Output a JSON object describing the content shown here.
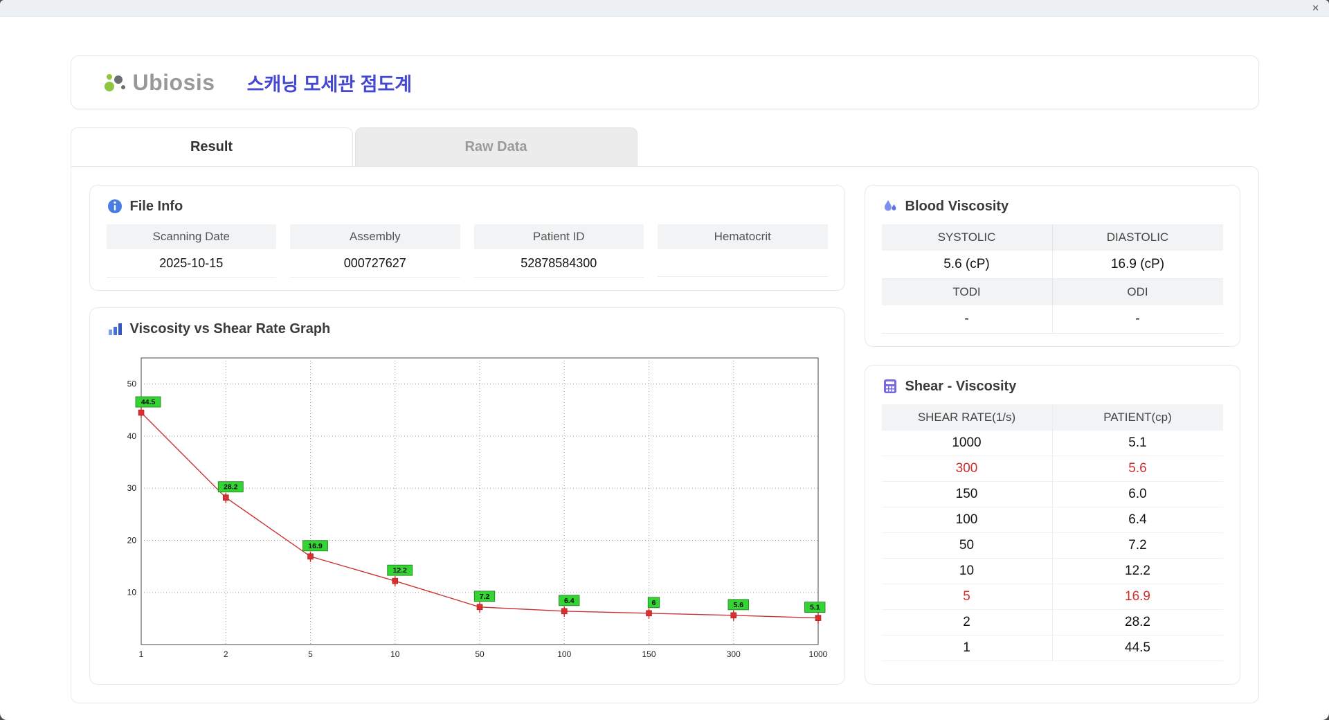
{
  "window": {
    "close_glyph": "✕"
  },
  "header": {
    "logo_text": "Ubiosis",
    "title": "스캐닝 모세관 점도계"
  },
  "tabs": [
    {
      "label": "Result",
      "active": true
    },
    {
      "label": "Raw Data",
      "active": false
    }
  ],
  "colors": {
    "title_blue": "#4447cf",
    "logo_grey": "#97989a",
    "logo_green": "#8dc63f",
    "highlight_red": "#cf2e2e",
    "chart_line": "#cc3333",
    "chart_marker": "#d63030",
    "chart_label_bg": "#35d435",
    "chart_label_border": "#1a7a1a"
  },
  "file_info": {
    "title": "File Info",
    "fields": [
      {
        "label": "Scanning Date",
        "value": "2025-10-15"
      },
      {
        "label": "Assembly",
        "value": "000727627"
      },
      {
        "label": "Patient ID",
        "value": "52878584300"
      },
      {
        "label": "Hematocrit",
        "value": ""
      }
    ]
  },
  "blood_viscosity": {
    "title": "Blood Viscosity",
    "rows": [
      {
        "headers": [
          "SYSTOLIC",
          "DIASTOLIC"
        ],
        "values": [
          "5.6 (cP)",
          "16.9 (cP)"
        ]
      },
      {
        "headers": [
          "TODI",
          "ODI"
        ],
        "values": [
          "-",
          "-"
        ]
      }
    ]
  },
  "shear_viscosity": {
    "title": "Shear - Viscosity",
    "columns": [
      "SHEAR RATE(1/s)",
      "PATIENT(cp)"
    ],
    "rows": [
      {
        "shear": "1000",
        "patient": "5.1",
        "highlight": false
      },
      {
        "shear": "300",
        "patient": "5.6",
        "highlight": true
      },
      {
        "shear": "150",
        "patient": "6.0",
        "highlight": false
      },
      {
        "shear": "100",
        "patient": "6.4",
        "highlight": false
      },
      {
        "shear": "50",
        "patient": "7.2",
        "highlight": false
      },
      {
        "shear": "10",
        "patient": "12.2",
        "highlight": false
      },
      {
        "shear": "5",
        "patient": "16.9",
        "highlight": true
      },
      {
        "shear": "2",
        "patient": "28.2",
        "highlight": false
      },
      {
        "shear": "1",
        "patient": "44.5",
        "highlight": false
      }
    ]
  },
  "chart_data": {
    "type": "line",
    "title": "Viscosity vs Shear Rate Graph",
    "x_labels": [
      "1",
      "2",
      "5",
      "10",
      "50",
      "100",
      "150",
      "300",
      "1000"
    ],
    "values": [
      44.5,
      28.2,
      16.9,
      12.2,
      7.2,
      6.4,
      6,
      5.6,
      5.1
    ],
    "point_labels": [
      "44.5",
      "28.2",
      "16.9",
      "12.2",
      "7.2",
      "6.4",
      "6",
      "5.6",
      "5.1"
    ],
    "y_ticks": [
      10,
      20,
      30,
      40,
      50
    ],
    "ylim": [
      0,
      55
    ],
    "grid": true,
    "xlabel": "",
    "ylabel": "",
    "legend": "none"
  }
}
